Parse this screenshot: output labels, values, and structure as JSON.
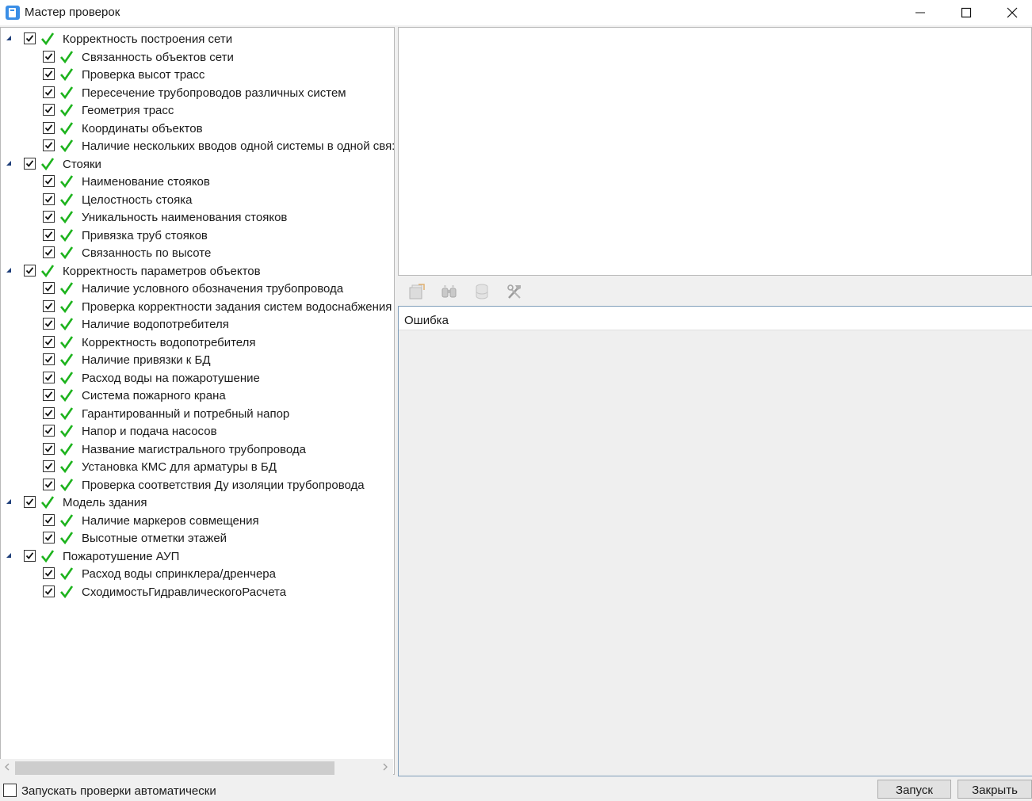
{
  "window": {
    "title": "Мастер проверок"
  },
  "tree": [
    {
      "label": "Корректность построения сети",
      "children": [
        "Связанность объектов сети",
        "Проверка высот трасс",
        "Пересечение трубопроводов различных систем",
        "Геометрия трасс",
        "Координаты объектов",
        "Наличие нескольких вводов одной системы в одной свя:"
      ]
    },
    {
      "label": "Стояки",
      "children": [
        "Наименование стояков",
        "Целостность стояка",
        "Уникальность наименования стояков",
        "Привязка труб стояков",
        "Связанность по высоте"
      ]
    },
    {
      "label": "Корректность параметров объектов",
      "children": [
        "Наличие условного обозначения трубопровода",
        "Проверка корректности задания систем водоснабжения",
        "Наличие водопотребителя",
        "Корректность водопотребителя",
        "Наличие привязки к БД",
        "Расход воды на пожаротушение",
        "Система пожарного крана",
        "Гарантированный и потребный напор",
        "Напор и подача насосов",
        "Название магистрального трубопровода",
        "Установка КМС для арматуры в БД",
        "Проверка соответствия Ду изоляции трубопровода"
      ]
    },
    {
      "label": "Модель здания",
      "children": [
        "Наличие маркеров совмещения",
        "Высотные отметки этажей"
      ]
    },
    {
      "label": "Пожаротушение АУП",
      "children": [
        "Расход воды спринклера/дренчера",
        "СходимостьГидравлическогоРасчета"
      ]
    }
  ],
  "results": {
    "column_header": "Ошибка"
  },
  "toolbar": {
    "icons": [
      "export-icon",
      "find-icon",
      "database-icon",
      "tools-icon"
    ]
  },
  "footer": {
    "auto_run_label": "Запускать проверки автоматически",
    "auto_run_checked": false,
    "run_button": "Запуск",
    "close_button": "Закрыть"
  },
  "colors": {
    "ok_check": "#1db31d",
    "expander": "#1f3f7a",
    "results_border": "#7f9db9"
  }
}
